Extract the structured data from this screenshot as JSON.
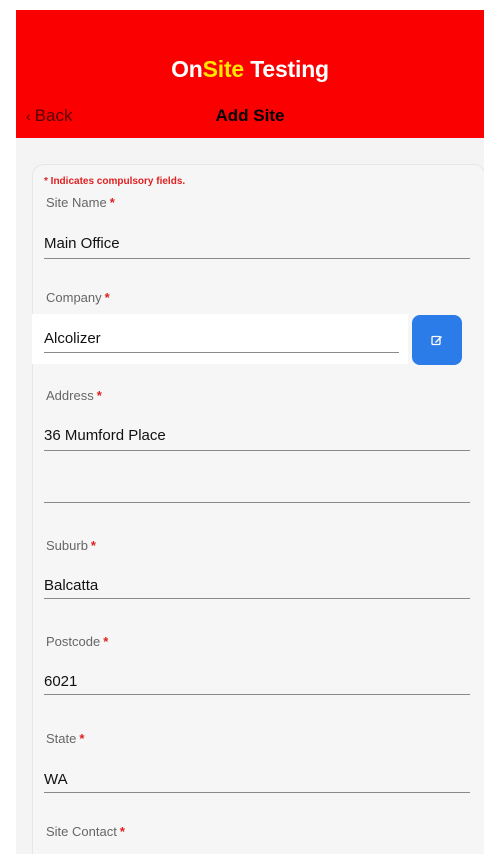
{
  "header": {
    "title_part1": "On",
    "title_part2": "Site",
    "title_part3": " Testing",
    "back_label": "Back",
    "page_title": "Add Site"
  },
  "form": {
    "required_note": "* Indicates compulsory fields.",
    "site_name": {
      "label": "Site Name",
      "value": "Main Office"
    },
    "company": {
      "label": "Company",
      "value": "Alcolizer"
    },
    "address": {
      "label": "Address",
      "line1": "36 Mumford Place",
      "line2": ""
    },
    "suburb": {
      "label": "Suburb",
      "value": "Balcatta"
    },
    "postcode": {
      "label": "Postcode",
      "value": "6021"
    },
    "state": {
      "label": "State",
      "value": "WA"
    },
    "site_contact": {
      "label": "Site Contact"
    },
    "required_mark": "*"
  },
  "colors": {
    "header_bg": "#fa0000",
    "accent_yellow": "#ffe600",
    "edit_button": "#2b7be8",
    "required_red": "#e01e1e"
  },
  "icons": {
    "back": "chevron-left-icon",
    "edit": "edit-icon"
  }
}
